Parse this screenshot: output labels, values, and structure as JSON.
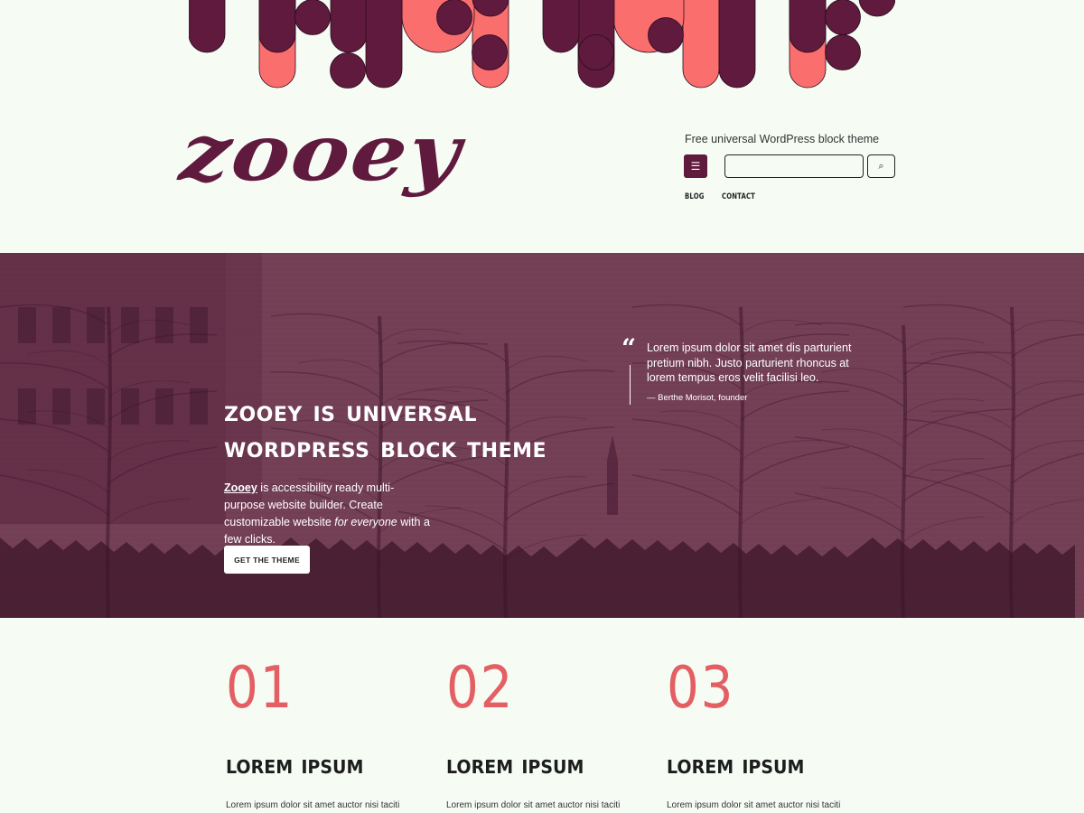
{
  "colors": {
    "background": "#f6fcf4",
    "brand": "#5f1a3e",
    "accent": "#fa6e6e",
    "hero": "#744056",
    "number": "#e35f64"
  },
  "header": {
    "logo": "zooey",
    "tagline": "Free universal WordPress block theme",
    "menu_icon": "☰",
    "search_icon": "⌕",
    "search_placeholder": "",
    "nav": [
      {
        "label": "BLOG"
      },
      {
        "label": "CONTACT"
      }
    ]
  },
  "hero": {
    "title_line1": "Zooey is universal",
    "title_line2": "WordPress block theme",
    "text_brand": "Zooey",
    "text_part1": " is accessibility ready multi-purpose website builder. Create customizable website ",
    "text_em": "for everyone",
    "text_part2": " with a few clicks.",
    "cta_label": "GET THE THEME",
    "quote_mark": "“",
    "quote": "Lorem ipsum dolor sit amet dis parturient pretium nibh. Justo parturient rhoncus at lorem tempus eros velit facilisi leo.",
    "quote_cite": "— Berthe Morisot, founder"
  },
  "features": [
    {
      "number": "01",
      "title": "Lorem ipsum",
      "body": "Lorem ipsum dolor sit amet auctor nisi taciti nulla. Auctor libero accumsan rhoncus sit sodales"
    },
    {
      "number": "02",
      "title": "Lorem ipsum",
      "body": "Lorem ipsum dolor sit amet auctor nisi taciti nulla. Auctor libero accumsan rhoncus sit sodales"
    },
    {
      "number": "03",
      "title": "Lorem ipsum",
      "body": "Lorem ipsum dolor sit amet auctor nisi taciti nulla. Auctor libero accumsan rhoncus sit sodales"
    }
  ]
}
